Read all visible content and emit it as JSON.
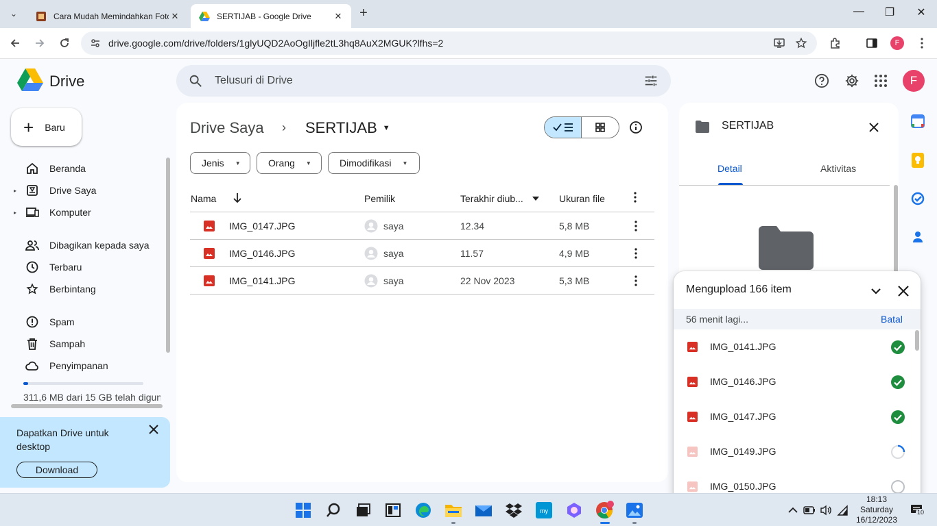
{
  "browser": {
    "tabs": [
      {
        "title": "Cara Mudah Memindahkan Foto",
        "active": false
      },
      {
        "title": "SERTIJAB - Google Drive",
        "active": true
      }
    ],
    "url": "drive.google.com/drive/folders/1glyUQD2AoOgIljfle2tL3hq8AuX2MGUK?lfhs=2",
    "profile_initial": "F"
  },
  "header": {
    "app_name": "Drive",
    "search_placeholder": "Telusuri di Drive",
    "avatar_initial": "F"
  },
  "sidebar": {
    "new_label": "Baru",
    "items": [
      {
        "label": "Beranda",
        "icon": "home-icon"
      },
      {
        "label": "Drive Saya",
        "icon": "my-drive-icon"
      },
      {
        "label": "Komputer",
        "icon": "computer-icon"
      },
      {
        "label": "Dibagikan kepada saya",
        "icon": "shared-icon"
      },
      {
        "label": "Terbaru",
        "icon": "clock-icon"
      },
      {
        "label": "Berbintang",
        "icon": "star-icon"
      },
      {
        "label": "Spam",
        "icon": "spam-icon"
      },
      {
        "label": "Sampah",
        "icon": "trash-icon"
      },
      {
        "label": "Penyimpanan",
        "icon": "cloud-icon"
      }
    ],
    "storage_text": "311,6 MB dari 15 GB telah digunakan",
    "storage_fraction": 0.02,
    "promo_text": "Dapatkan Drive untuk desktop",
    "promo_button": "Download"
  },
  "main": {
    "breadcrumb_root": "Drive Saya",
    "breadcrumb_sep": "›",
    "breadcrumb_current": "SERTIJAB",
    "filters": [
      "Jenis",
      "Orang",
      "Dimodifikasi"
    ],
    "columns": {
      "name": "Nama",
      "owner": "Pemilik",
      "modified": "Terakhir diub...",
      "size": "Ukuran file"
    },
    "files": [
      {
        "name": "IMG_0147.JPG",
        "owner": "saya",
        "modified": "12.34",
        "size": "5,8 MB"
      },
      {
        "name": "IMG_0146.JPG",
        "owner": "saya",
        "modified": "11.57",
        "size": "4,9 MB"
      },
      {
        "name": "IMG_0141.JPG",
        "owner": "saya",
        "modified": "22 Nov 2023",
        "size": "5,3 MB"
      }
    ]
  },
  "details": {
    "title": "SERTIJAB",
    "tabs": [
      "Detail",
      "Aktivitas"
    ]
  },
  "upload": {
    "title": "Mengupload 166 item",
    "eta": "56 menit lagi...",
    "cancel": "Batal",
    "items": [
      {
        "name": "IMG_0141.JPG",
        "state": "done"
      },
      {
        "name": "IMG_0146.JPG",
        "state": "done"
      },
      {
        "name": "IMG_0147.JPG",
        "state": "done"
      },
      {
        "name": "IMG_0149.JPG",
        "state": "uploading"
      },
      {
        "name": "IMG_0150.JPG",
        "state": "pending"
      }
    ]
  },
  "taskbar": {
    "time": "18:13",
    "day": "Saturday",
    "date": "16/12/2023",
    "notification_count": "10"
  },
  "colors": {
    "accent": "#0b57d0",
    "image_icon": "#d93025",
    "done_green": "#1e8e3e",
    "selected_chip": "#c2e7ff"
  }
}
